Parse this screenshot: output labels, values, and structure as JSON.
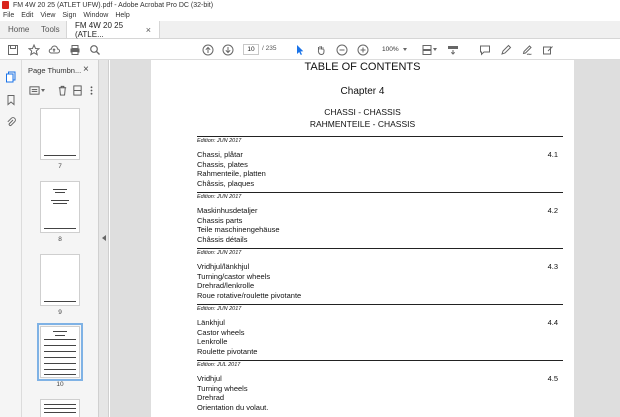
{
  "window": {
    "title": "FM 4W 20 25 (ATLET UFW).pdf - Adobe Acrobat Pro DC (32-bit)"
  },
  "menu": [
    "File",
    "Edit",
    "View",
    "Sign",
    "Window",
    "Help"
  ],
  "tabs": {
    "home": "Home",
    "tools": "Tools",
    "document": "FM 4W 20 25 (ATLE...",
    "close": "×"
  },
  "toolbar": {
    "page_current": "10",
    "page_total": "/ 235",
    "zoom": "100%"
  },
  "sidebar": {
    "title": "Page Thumbn...",
    "close": "×",
    "thumbnails": [
      {
        "label": "7"
      },
      {
        "label": "8"
      },
      {
        "label": "9"
      },
      {
        "label": "10",
        "selected": true
      },
      {
        "label": ""
      }
    ]
  },
  "document": {
    "toc_title": "TABLE OF CONTENTS",
    "chapter": "Chapter 4",
    "header_line1": "CHASSI - CHASSIS",
    "header_line2": "RAHMENTEILE - CHASSIS",
    "entries": [
      {
        "edition": "Edition: JUN 2017",
        "lines": [
          "Chassi, plåtar",
          "Chassis, plates",
          "Rahmenteile, platten",
          "Châssis, plaques"
        ],
        "number": "4.1"
      },
      {
        "edition": "Edition: JUN 2017",
        "lines": [
          "Maskinhusdetaljer",
          "Chassis parts",
          "Teile maschinengehäuse",
          "Châssis détails"
        ],
        "number": "4.2"
      },
      {
        "edition": "Edition: JUN 2017",
        "lines": [
          "Vridhjul/länkhjul",
          "Turning/castor wheels",
          "Drehrad/lenkrolle",
          "Roue rotative/roulette pivotante"
        ],
        "number": "4.3"
      },
      {
        "edition": "Edition: JUN 2017",
        "lines": [
          "Länkhjul",
          "Castor wheels",
          "Lenkrolle",
          "Roulette pivotante"
        ],
        "number": "4.4"
      },
      {
        "edition": "Edition: JUL 2017",
        "lines": [
          "Vridhjul",
          "Turning wheels",
          "Drehrad",
          "Orientation du volaut."
        ],
        "number": "4.5"
      }
    ]
  }
}
